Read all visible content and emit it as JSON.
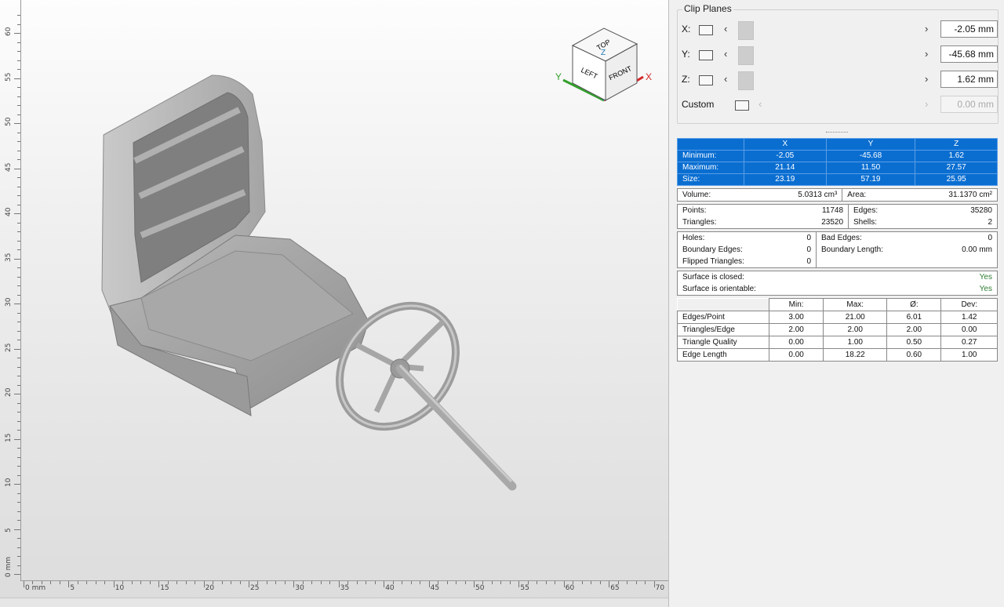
{
  "viewport": {
    "ruler_v": [
      "0 mm",
      "5",
      "10",
      "15",
      "20",
      "25",
      "30",
      "35",
      "40",
      "45",
      "50",
      "55",
      "60"
    ],
    "ruler_h": [
      "0 mm",
      "5",
      "10",
      "15",
      "20",
      "25",
      "30",
      "35",
      "40",
      "45",
      "50",
      "55",
      "60",
      "65",
      "70"
    ],
    "navcube": {
      "top": "TOP",
      "left": "LEFT",
      "front": "FRONT",
      "axis_y": "Y",
      "axis_x": "X",
      "axis_z": "Z"
    }
  },
  "clip_planes": {
    "title": "Clip Planes",
    "rows": [
      {
        "axis": "X:",
        "value": "-2.05 mm",
        "enabled": true
      },
      {
        "axis": "Y:",
        "value": "-45.68 mm",
        "enabled": true
      },
      {
        "axis": "Z:",
        "value": "1.62 mm",
        "enabled": true
      },
      {
        "axis": "Custom",
        "value": "0.00 mm",
        "enabled": false
      }
    ]
  },
  "bounds": {
    "headers": [
      "X",
      "Y",
      "Z"
    ],
    "rows": [
      {
        "label": "Minimum:",
        "x": "-2.05",
        "y": "-45.68",
        "z": "1.62"
      },
      {
        "label": "Maximum:",
        "x": "21.14",
        "y": "11.50",
        "z": "27.57"
      },
      {
        "label": "Size:",
        "x": "23.19",
        "y": "57.19",
        "z": "25.95"
      }
    ]
  },
  "volume_area": {
    "volume_label": "Volume:",
    "volume": "5.0313 cm³",
    "area_label": "Area:",
    "area": "31.1370 cm²"
  },
  "counts": {
    "points_label": "Points:",
    "points": "11748",
    "edges_label": "Edges:",
    "edges": "35280",
    "triangles_label": "Triangles:",
    "triangles": "23520",
    "shells_label": "Shells:",
    "shells": "2"
  },
  "errors": {
    "holes_label": "Holes:",
    "holes": "0",
    "bad_edges_label": "Bad Edges:",
    "bad_edges": "0",
    "boundary_edges_label": "Boundary Edges:",
    "boundary_edges": "0",
    "boundary_length_label": "Boundary Length:",
    "boundary_length": "0.00 mm",
    "flipped_label": "Flipped Triangles:",
    "flipped": "0"
  },
  "surface": {
    "closed_label": "Surface is closed:",
    "closed": "Yes",
    "orientable_label": "Surface is orientable:",
    "orientable": "Yes"
  },
  "quality": {
    "headers": [
      "Min:",
      "Max:",
      "Ø:",
      "Dev:"
    ],
    "rows": [
      {
        "label": "Edges/Point",
        "min": "3.00",
        "max": "21.00",
        "avg": "6.01",
        "dev": "1.42"
      },
      {
        "label": "Triangles/Edge",
        "min": "2.00",
        "max": "2.00",
        "avg": "2.00",
        "dev": "0.00"
      },
      {
        "label": "Triangle Quality",
        "min": "0.00",
        "max": "1.00",
        "avg": "0.50",
        "dev": "0.27"
      },
      {
        "label": "Edge Length",
        "min": "0.00",
        "max": "18.22",
        "avg": "0.60",
        "dev": "1.00"
      }
    ]
  }
}
